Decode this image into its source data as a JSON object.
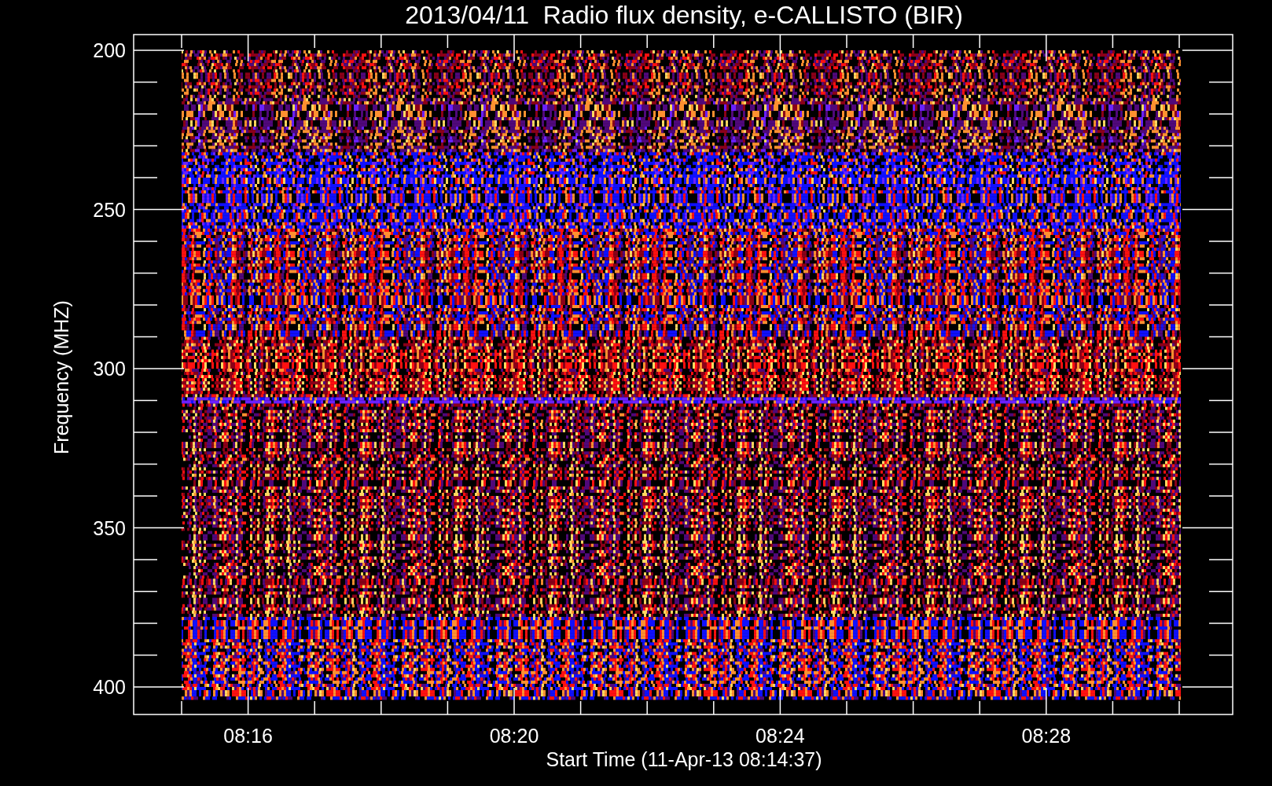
{
  "title": "2013/04/11  Radio flux density, e-CALLISTO (BIR)",
  "y_axis": {
    "label": "Frequency (MHZ)",
    "ticks": [
      "200",
      "250",
      "300",
      "350",
      "400"
    ]
  },
  "x_axis": {
    "label": "Start Time (11-Apr-13 08:14:37)",
    "ticks": [
      "08:16",
      "08:20",
      "08:24",
      "08:28"
    ]
  }
}
